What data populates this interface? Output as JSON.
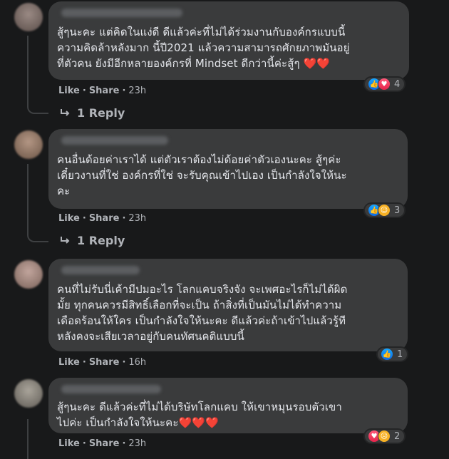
{
  "comments": [
    {
      "lines": [
        "สู้ๆนะคะ แต่คิดในแง่ดี ดีแล้วค่ะที่ไม่ได้ร่วมงานกับองค์กรแบบนี้",
        "ความคิดล้าหลังมาก นี้ปี2021 แล้วความสามารถศักยภาพมันอยู่",
        "ที่ตัวคน ยังมีอีกหลายองค์กรที่ Mindset ดีกว่านี้ค่ะสู้ๆ"
      ],
      "emoji": "❤️❤️",
      "reactions": [
        "like-icon",
        "love-icon"
      ],
      "reaction_count": "4",
      "like_label": "Like",
      "share_label": "Share",
      "time": "23h",
      "reply_label": "1 Reply"
    },
    {
      "lines": [
        "คนอื่นด้อยค่าเราได้ แต่ตัวเราต้องไม่ด้อยค่าตัวเองนะคะ สู้ๆค่ะ",
        "เดี๋ยวงานที่ใช่ องค์กรที่ใช่ จะรับคุณเข้าไปเอง เป็นกำลังใจให้นะ",
        "คะ"
      ],
      "emoji": "",
      "reactions": [
        "like-icon",
        "care-icon"
      ],
      "reaction_count": "3",
      "like_label": "Like",
      "share_label": "Share",
      "time": "23h",
      "reply_label": "1 Reply"
    },
    {
      "lines": [
        "คนที่ไม่รับนี่เค้ามีปมอะไร โลกแคบจริงจัง จะเพศอะไรก็ไม่ได้ผิด",
        "มั้ย ทุกคนควรมีสิทธิ์เลือกที่จะเป็น ถ้าสิ่งที่เป็นมันไม่ได้ทำความ",
        "เดือดร้อนให้ใคร เป็นกำลังใจให้นะคะ ดีแล้วค่ะถ้าเข้าไปแล้วรู้ที",
        "หลังคงจะเสียเวลาอยู่กับคนทัศนคติแบบนี้"
      ],
      "emoji": "",
      "reactions": [
        "like-icon"
      ],
      "reaction_count": "1",
      "like_label": "Like",
      "share_label": "Share",
      "time": "16h"
    },
    {
      "lines": [
        "สู้ๆนะคะ ดีแล้วค่ะที่ไม่ได้บริษัทโลกแคบ ให้เขาหมุนรอบตัวเขา",
        "ไปค่ะ เป็นกำลังใจให้นะคะ"
      ],
      "emoji": "❤️❤️❤️",
      "reactions": [
        "love-icon",
        "sad-icon"
      ],
      "reaction_count": "2",
      "like_label": "Like",
      "share_label": "Share",
      "time": "23h"
    }
  ],
  "colors": {
    "background": "#18191a",
    "bubble": "#3a3b3c",
    "text": "#e4e6eb",
    "secondary": "#b0b3b8",
    "like_blue": "#0a6ae8",
    "love_red": "#e7244b"
  }
}
